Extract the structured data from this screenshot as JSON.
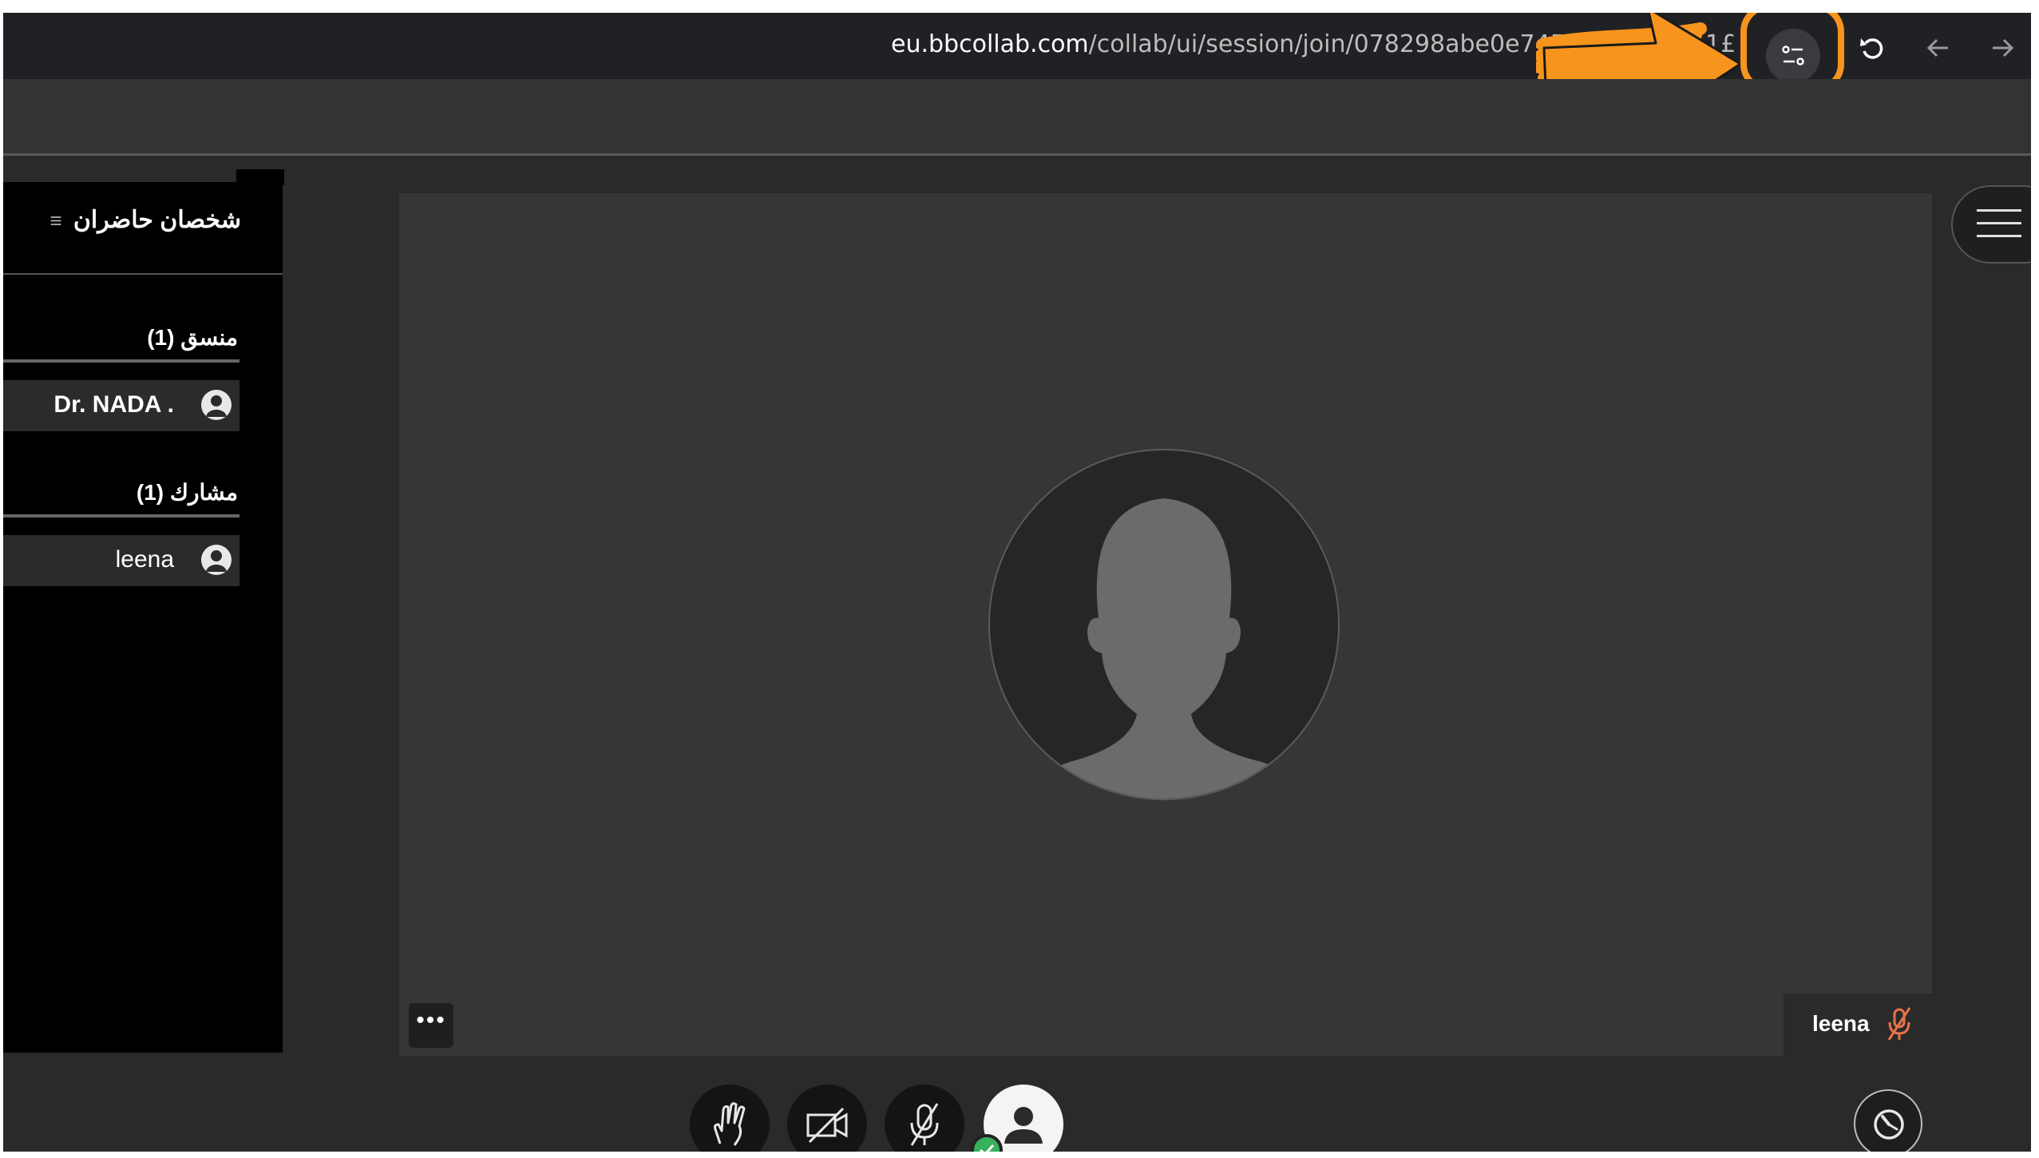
{
  "browser": {
    "url_host": "eu.bbcollab.com",
    "url_path": "/collab/ui/session/join/078298abe0e745",
    "url_tail": "1£"
  },
  "attendees": {
    "title": "شخصان حاضران",
    "moderators_header": "منسق (1)",
    "participants_header": "مشارك (1)",
    "moderators": [
      {
        "name": "Dr. NADA ."
      }
    ],
    "participants": [
      {
        "name": "leena"
      }
    ]
  },
  "video": {
    "speaker_name": "leena",
    "more_label": "•••"
  },
  "colors": {
    "highlight": "#f7941d",
    "mic_muted": "#e8734a",
    "ok_green": "#36b15c"
  }
}
